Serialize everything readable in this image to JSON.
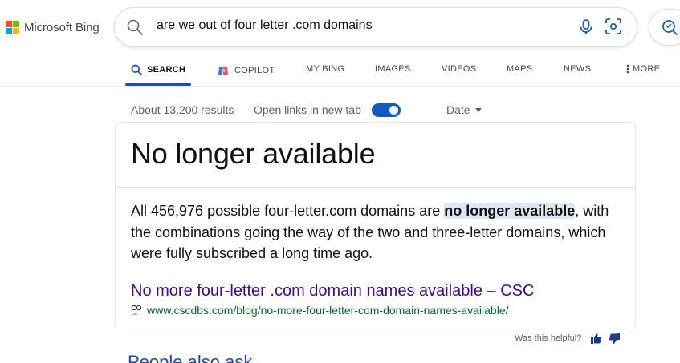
{
  "brand": {
    "name": "Microsoft Bing",
    "logo_colors": [
      "#f25022",
      "#7fba00",
      "#00a4ef",
      "#ffb900"
    ]
  },
  "search": {
    "query": "are we out of four letter .com domains"
  },
  "tabs": [
    {
      "label": "SEARCH",
      "icon": "search-icon",
      "active": true
    },
    {
      "label": "COPILOT",
      "icon": "copilot-icon"
    },
    {
      "label": "MY BING"
    },
    {
      "label": "IMAGES"
    },
    {
      "label": "VIDEOS"
    },
    {
      "label": "MAPS"
    },
    {
      "label": "NEWS"
    },
    {
      "label": "MORE",
      "icon": "kebab-icon"
    }
  ],
  "results_meta": {
    "count": "About 13,200 results",
    "open_links_label": "Open links in new tab",
    "open_links_enabled": true,
    "date_filter": "Date"
  },
  "answer_card": {
    "title": "No longer available",
    "snippet_before": "All 456,976 possible four-letter.com domains are ",
    "snippet_highlight": "no longer available",
    "snippet_after": ", with the combinations going the way of the two and three-letter domains, which were fully subscribed a long time ago.",
    "source_title": "No more four-letter .com domain names available – CSC",
    "source_url": "www.cscdbs.com/blog/no-more-four-letter-com-domain-names-available/"
  },
  "feedback": {
    "label": "Was this helpful?"
  },
  "people_also_ask": "People also ask",
  "colors": {
    "accent": "#174ae4",
    "link": "#4007a2",
    "url": "#006d21",
    "toggle": "#0e5ac2",
    "highlight": "#dde6f2"
  }
}
